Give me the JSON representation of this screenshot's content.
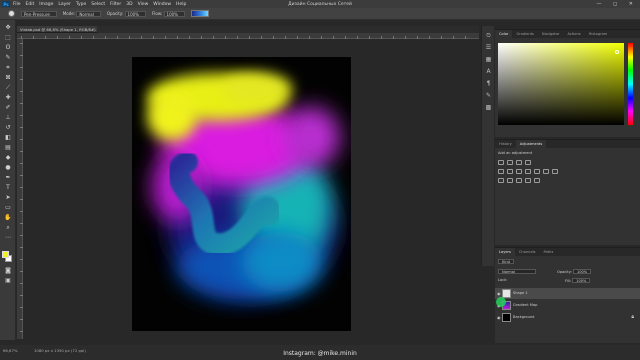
{
  "window": {
    "title": "Дизайн Социальных Сетей",
    "controls": "— ◻ ✕"
  },
  "app": {
    "logo": "Ps"
  },
  "menu": [
    "File",
    "Edit",
    "Image",
    "Layer",
    "Type",
    "Select",
    "Filter",
    "3D",
    "View",
    "Window",
    "Help"
  ],
  "options": {
    "mode_label": "Mode:",
    "mode_value": "Normal",
    "opacity_label": "Opacity:",
    "opacity_value": "100%",
    "flow_label": "Flow:",
    "flow_value": "100%",
    "brush_name": "Pen-Pressure"
  },
  "document": {
    "tab_label": "Vintab.psd @ 66,6% (Shape 1, RGB/8#) *"
  },
  "status": {
    "zoom": "66,67%",
    "docinfo": "1080 px x 1350 px (72 ppi)"
  },
  "watermark": "Instagram: @mike.minin",
  "color_panel": {
    "tabs": [
      "Color",
      "Gradients",
      "Navigator",
      "Actions",
      "Histogram"
    ],
    "active_tab": "Color"
  },
  "adjustments_panel": {
    "tabs": [
      "History",
      "Adjustments"
    ],
    "active_tab": "Adjustments",
    "label": "Add an adjustment"
  },
  "layers_panel": {
    "tabs": [
      "Layers",
      "Channels",
      "Paths"
    ],
    "active_tab": "Layers",
    "kind_label": "Kind",
    "blend_mode": "Normal",
    "opacity_label": "Opacity:",
    "opacity_value": "100%",
    "lock_label": "Lock:",
    "fill_label": "Fill:",
    "fill_value": "100%",
    "layers": [
      {
        "name": "Shape 1",
        "selected": true
      },
      {
        "name": "Gradient Map",
        "selected": false
      },
      {
        "name": "Background",
        "selected": false
      }
    ]
  },
  "colors": {
    "foreground": "#f1f01a",
    "background": "#ffffff",
    "accent_picker": "#f2ff00"
  }
}
